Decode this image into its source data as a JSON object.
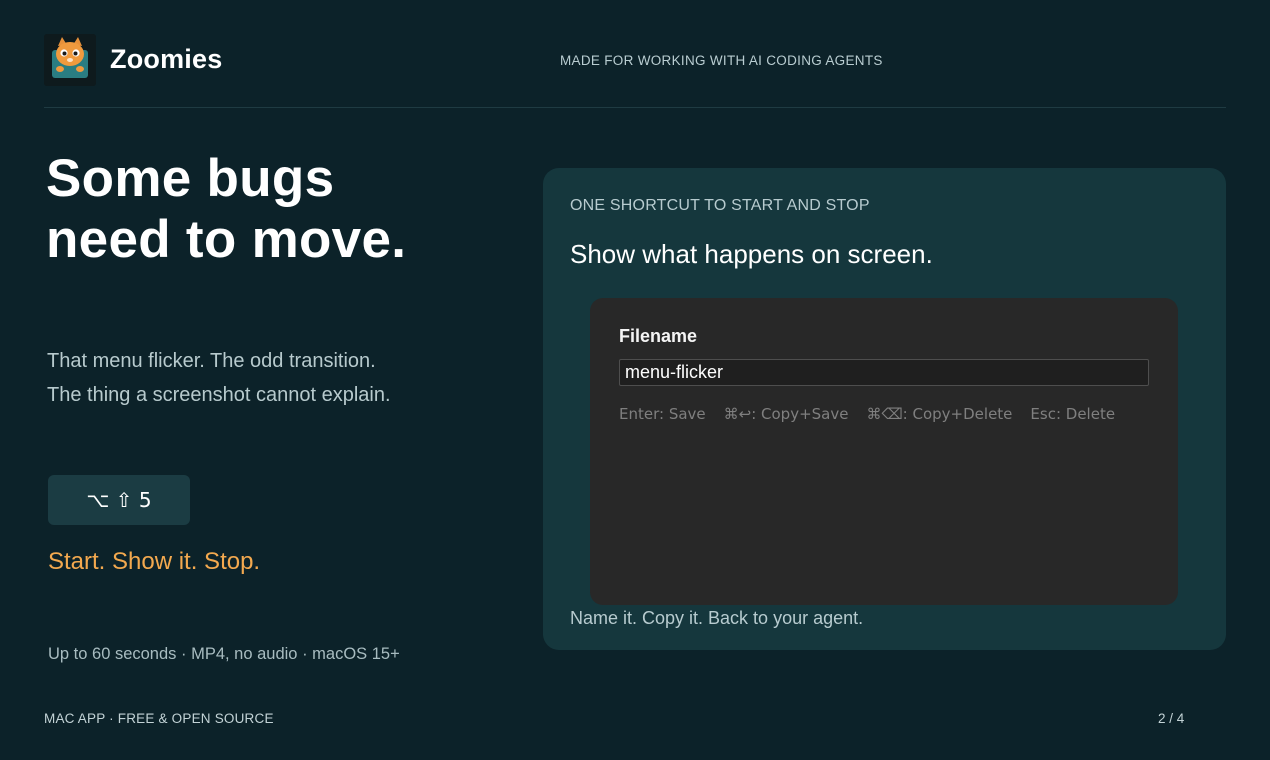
{
  "header": {
    "brand_name": "Zoomies",
    "logo_icon": "cat-mascot-icon",
    "tagline": "MADE FOR WORKING WITH AI CODING AGENTS"
  },
  "hero": {
    "headline_line1": "Some bugs",
    "headline_line2": "need to move.",
    "desc_line1": "That menu flicker. The odd transition.",
    "desc_line2": "The thing a screenshot cannot explain.",
    "shortcut": "⌥ ⇧ 5",
    "cta": "Start. Show it. Stop.",
    "specs": "Up to 60 seconds · MP4, no audio · macOS 15+"
  },
  "card": {
    "eyebrow": "ONE SHORTCUT TO START AND STOP",
    "title": "Show what happens on screen.",
    "dialog": {
      "label": "Filename",
      "input_value": "menu-flicker",
      "hints": [
        "Enter: Save",
        "⌘↩: Copy+Save",
        "⌘⌫: Copy+Delete",
        "Esc: Delete"
      ]
    },
    "footer": "Name it. Copy it. Back to your agent."
  },
  "footer": {
    "left": "MAC APP · FREE & OPEN SOURCE",
    "page_indicator": "2 / 4"
  },
  "colors": {
    "background": "#0c2229",
    "card": "#15373d",
    "accent": "#f3a94f",
    "dialog": "#282828"
  }
}
